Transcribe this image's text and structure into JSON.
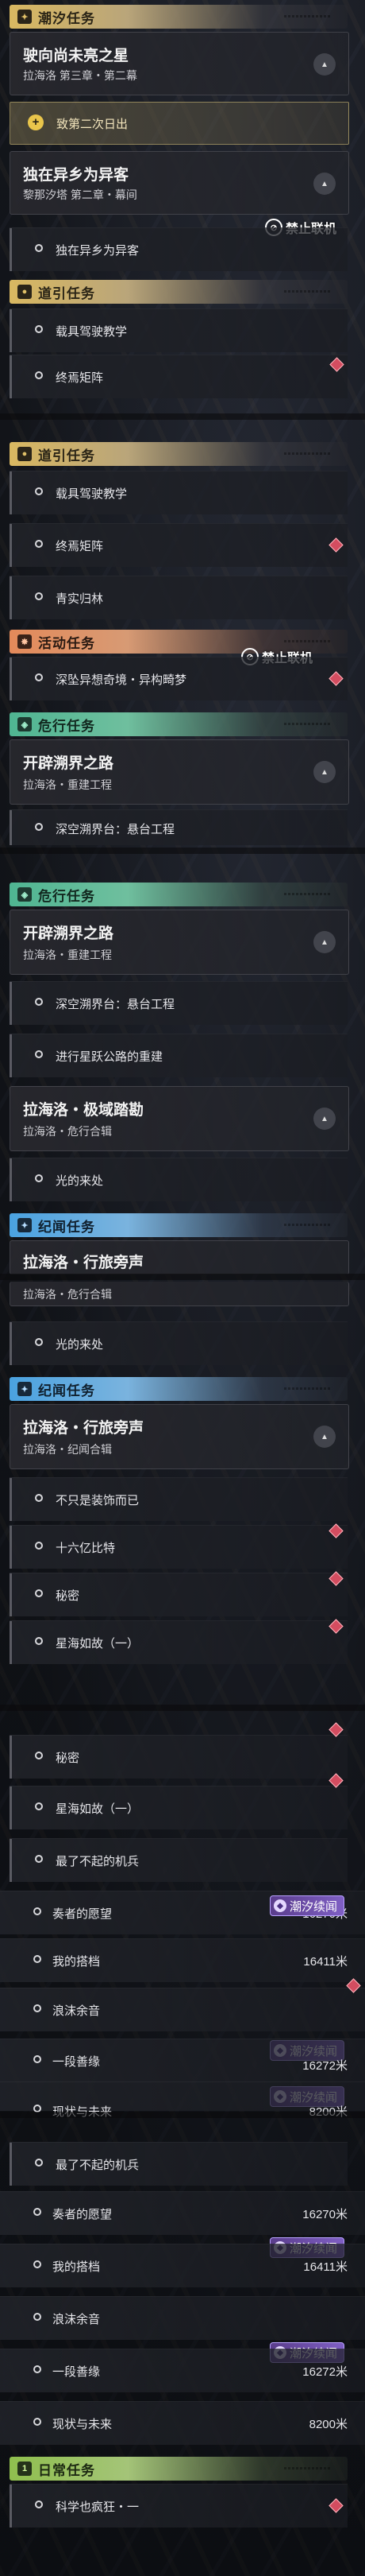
{
  "sections": {
    "chaoxi": "潮汐任务",
    "daoyin": "道引任务",
    "huodong": "活动任务",
    "weixing": "危行任务",
    "jiwen": "纪闻任务",
    "richang": "日常任务"
  },
  "quests": {
    "main1_title": "驶向尚未亮之星",
    "main1_sub": "拉海洛 第三章・第二幕",
    "main1_step": "致第二次日出",
    "main2_title": "独在异乡为异客",
    "main2_sub": "黎那汐塔 第二章・幕间",
    "main2_step": "独在异乡为异客",
    "guide1": "载具驾驶教学",
    "guide2": "终焉矩阵",
    "guide3": "青实归林",
    "event1": "深坠异想奇境・异构畸梦",
    "danger_title": "开辟溯界之路",
    "danger_sub": "拉海洛・重建工程",
    "danger_step1": "深空溯界台：悬台工程",
    "danger_step2": "进行星跃公路的重建",
    "danger2_title": "拉海洛・极域踏勘",
    "danger2_sub": "拉海洛・危行合辑",
    "danger2_step": "光的来处",
    "lore_title": "拉海洛・行旅旁声",
    "lore_sub": "拉海洛・纪闻合辑",
    "lore1": "不只是装饰而已",
    "lore2": "十六亿比特",
    "lore3": "秘密",
    "lore4": "星海如故（一）",
    "lore5": "最了不起的机兵",
    "lore6": "奏者的愿望",
    "lore7": "我的搭档",
    "lore8": "浪沫余音",
    "lore9": "一段善缘",
    "lore10": "现状与未来",
    "daily1": "科学也疯狂・一"
  },
  "distances": {
    "d6": "16270米",
    "d7": "16411米",
    "d9": "16272米",
    "d10": "8200米"
  },
  "badges": {
    "offline": "禁止联机",
    "tide": "潮汐续闻"
  },
  "colors": {
    "gold": "#d9b861",
    "teal": "#4fb592",
    "orange": "#e48a5a",
    "blue": "#4aa2e0",
    "green": "#8fbf4e",
    "tracked_marker": "#d34d60"
  },
  "icons": [
    "plus-icon",
    "pin-icon",
    "flame-icon",
    "shield-icon",
    "sparkle-icon",
    "day-icon",
    "chevron-up-icon",
    "radio-icon",
    "diamond-marker-icon",
    "no-coop-icon",
    "tide-badge-icon"
  ]
}
